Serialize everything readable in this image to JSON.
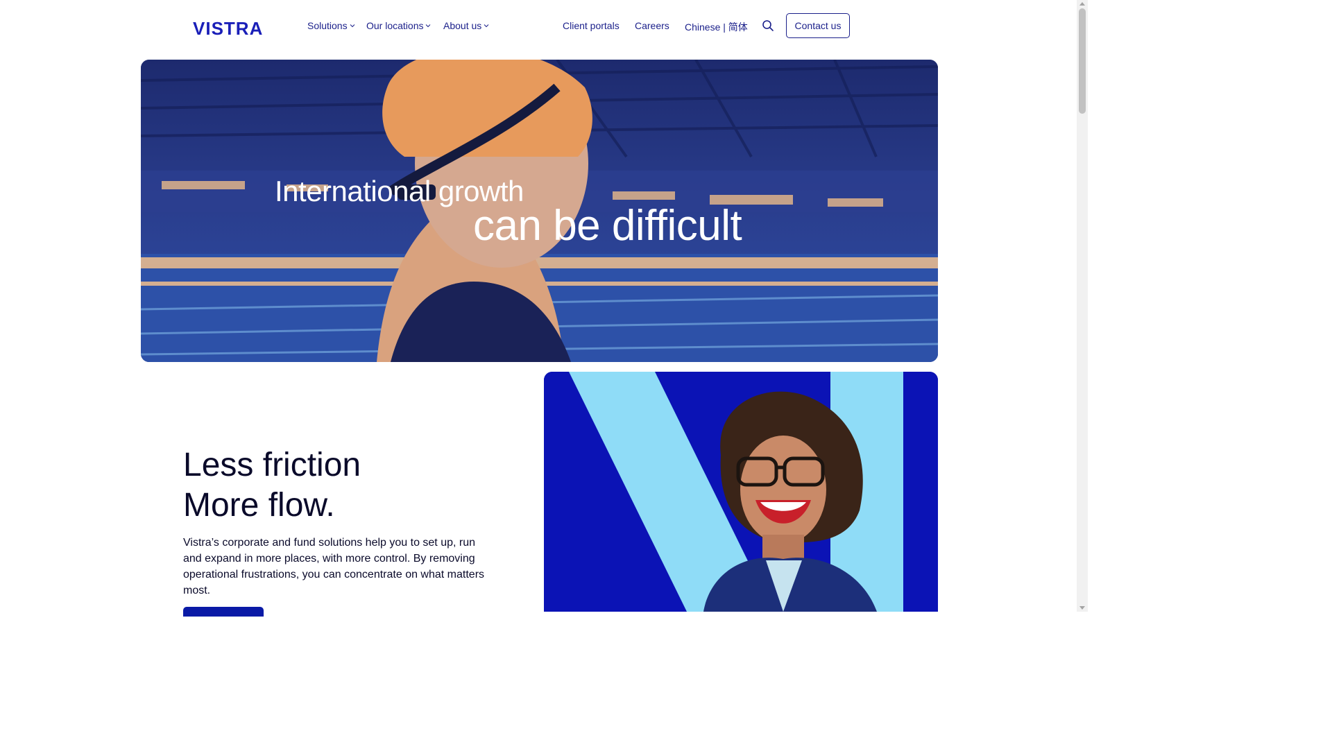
{
  "brand": {
    "logo_text": "VISTRA",
    "accent": "#1a1fb8",
    "dark_blue": "#0b13b5",
    "light_blue": "#8fdcf7"
  },
  "nav": {
    "primary": [
      {
        "label": "Solutions",
        "icon": "chevron-down-icon"
      },
      {
        "label": "Our locations",
        "icon": "chevron-down-icon"
      },
      {
        "label": "About us",
        "icon": "chevron-down-icon"
      }
    ],
    "secondary": [
      {
        "label": "Client portals"
      },
      {
        "label": "Careers"
      },
      {
        "label": "Chinese | 简体"
      }
    ],
    "search_icon": "search-icon",
    "contact_label": "Contact us"
  },
  "hero": {
    "line1": "International growth",
    "line2": "can be difficult"
  },
  "intro": {
    "headline_line1": "Less friction",
    "headline_line2": "More flow.",
    "body": "Vistra’s corporate and fund solutions help you to set up, run and expand in more places, with more control. By removing operational frustrations, you can concentrate on what matters most."
  }
}
